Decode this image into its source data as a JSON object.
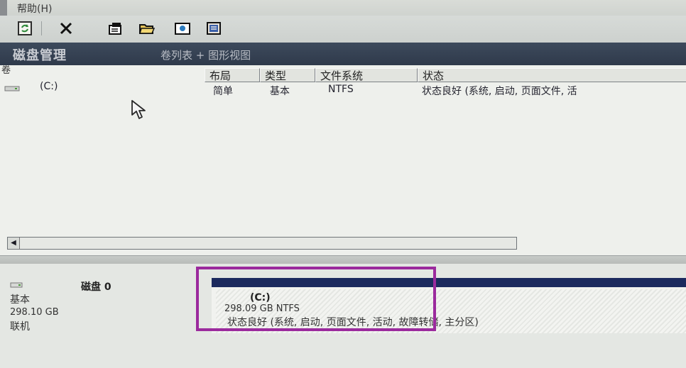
{
  "menu": {
    "help_label": "帮助(H)"
  },
  "toolbar": {
    "buttons": [
      {
        "icon": "refresh-icon"
      },
      {
        "icon": "delete-icon"
      },
      {
        "icon": "properties-icon"
      },
      {
        "icon": "open-icon"
      },
      {
        "icon": "explore-icon"
      },
      {
        "icon": "help-book-icon"
      }
    ]
  },
  "title": {
    "main": "磁盘管理",
    "view": "卷列表 + 图形视图"
  },
  "list": {
    "col_volume": "卷",
    "columns": [
      "布局",
      "类型",
      "文件系统",
      "状态"
    ],
    "rows": [
      {
        "volume": "(C:)",
        "layout": "简单",
        "type": "基本",
        "fs": "NTFS",
        "status": "状态良好 (系统, 启动, 页面文件, 活"
      }
    ]
  },
  "disk": {
    "name": "磁盘 0",
    "type": "基本",
    "size": "298.10 GB",
    "status": "联机"
  },
  "partition": {
    "name": "(C:)",
    "size": "298.09 GB NTFS",
    "status": "状态良好 (系统, 启动, 页面文件, 活动, 故障转储, 主分区)"
  },
  "colors": {
    "highlight": "#9b2a9d",
    "partition_bar": "#1c2a5e",
    "title_bg": "#2f3a4b"
  }
}
